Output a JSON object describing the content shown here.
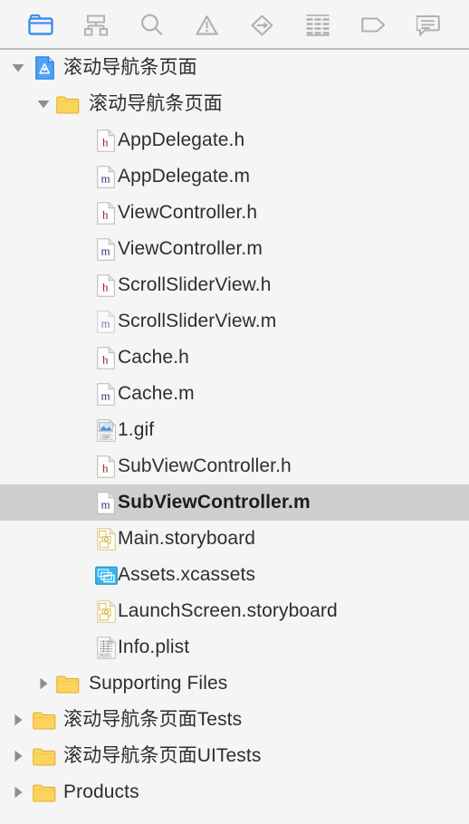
{
  "toolbar": {
    "items": [
      {
        "icon": "folder-icon",
        "label": "Show the Project navigator",
        "active": true
      },
      {
        "icon": "source-control-icon",
        "label": "Show the Source Control navigator",
        "active": false
      },
      {
        "icon": "search-icon",
        "label": "Show the Find navigator",
        "active": false
      },
      {
        "icon": "warning-triangle-icon",
        "label": "Show the Issue navigator",
        "active": false
      },
      {
        "icon": "test-diamond-icon",
        "label": "Show the Test navigator",
        "active": false
      },
      {
        "icon": "debug-list-icon",
        "label": "Show the Debug navigator",
        "active": false
      },
      {
        "icon": "tag-icon",
        "label": "Show the Breakpoint navigator",
        "active": false
      },
      {
        "icon": "report-bubble-icon",
        "label": "Show the Report navigator",
        "active": false
      }
    ]
  },
  "tree": {
    "rows": [
      {
        "label": "滚动导航条页面",
        "level": 0,
        "icon": "xcode-project-icon",
        "twisty": "down",
        "selected": false,
        "dim": false
      },
      {
        "label": "滚动导航条页面",
        "level": 1,
        "icon": "folder-icon",
        "twisty": "down",
        "selected": false,
        "dim": false
      },
      {
        "label": "AppDelegate.h",
        "level": 2,
        "icon": "header-file-icon",
        "twisty": "none",
        "selected": false,
        "dim": false
      },
      {
        "label": "AppDelegate.m",
        "level": 2,
        "icon": "source-file-icon",
        "twisty": "none",
        "selected": false,
        "dim": false
      },
      {
        "label": "ViewController.h",
        "level": 2,
        "icon": "header-file-icon",
        "twisty": "none",
        "selected": false,
        "dim": false
      },
      {
        "label": "ViewController.m",
        "level": 2,
        "icon": "source-file-icon",
        "twisty": "none",
        "selected": false,
        "dim": false
      },
      {
        "label": "ScrollSliderView.h",
        "level": 2,
        "icon": "header-file-icon",
        "twisty": "none",
        "selected": false,
        "dim": false
      },
      {
        "label": "ScrollSliderView.m",
        "level": 2,
        "icon": "source-file-icon",
        "twisty": "none",
        "selected": false,
        "dim": true
      },
      {
        "label": "Cache.h",
        "level": 2,
        "icon": "header-file-icon",
        "twisty": "none",
        "selected": false,
        "dim": false
      },
      {
        "label": "Cache.m",
        "level": 2,
        "icon": "source-file-icon",
        "twisty": "none",
        "selected": false,
        "dim": false
      },
      {
        "label": "1.gif",
        "level": 2,
        "icon": "gif-image-icon",
        "twisty": "none",
        "selected": false,
        "dim": false
      },
      {
        "label": "SubViewController.h",
        "level": 2,
        "icon": "header-file-icon",
        "twisty": "none",
        "selected": false,
        "dim": false
      },
      {
        "label": "SubViewController.m",
        "level": 2,
        "icon": "source-file-icon",
        "twisty": "none",
        "selected": true,
        "dim": false
      },
      {
        "label": "Main.storyboard",
        "level": 2,
        "icon": "storyboard-icon",
        "twisty": "none",
        "selected": false,
        "dim": false
      },
      {
        "label": "Assets.xcassets",
        "level": 2,
        "icon": "xcassets-icon",
        "twisty": "none",
        "selected": false,
        "dim": false
      },
      {
        "label": "LaunchScreen.storyboard",
        "level": 2,
        "icon": "storyboard-icon",
        "twisty": "none",
        "selected": false,
        "dim": false
      },
      {
        "label": "Info.plist",
        "level": 2,
        "icon": "plist-icon",
        "twisty": "none",
        "selected": false,
        "dim": false
      },
      {
        "label": "Supporting Files",
        "level": 1,
        "icon": "folder-icon",
        "twisty": "right",
        "selected": false,
        "dim": false
      },
      {
        "label": "滚动导航条页面Tests",
        "level": 0,
        "icon": "folder-icon",
        "twisty": "right",
        "selected": false,
        "dim": false
      },
      {
        "label": "滚动导航条页面UITests",
        "level": 0,
        "icon": "folder-icon",
        "twisty": "right",
        "selected": false,
        "dim": false
      },
      {
        "label": "Products",
        "level": 0,
        "icon": "folder-icon",
        "twisty": "right",
        "selected": false,
        "dim": false
      }
    ]
  },
  "colors": {
    "background": "#f5f5f5",
    "selection": "#cfcfcf",
    "folder": "#ffd champion",
    "folder_fill": "#fcd966",
    "accent_blue": "#3b8ff0",
    "toolbar_icon": "#b0b0b0",
    "text": "#2e2e2e",
    "header_letter": "#a32020",
    "source_letter": "#3b2d7a"
  }
}
